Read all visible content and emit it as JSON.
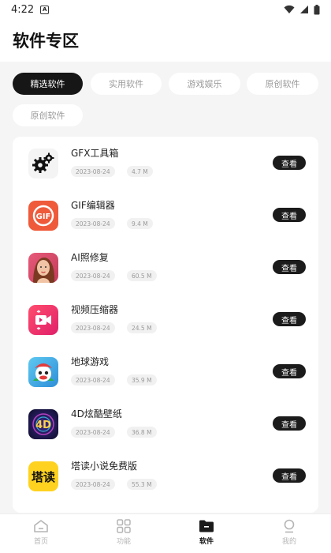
{
  "status_bar": {
    "time": "4:22",
    "badge": "A"
  },
  "header": {
    "title": "软件专区"
  },
  "tabs": [
    {
      "label": "精选软件",
      "active": true
    },
    {
      "label": "实用软件",
      "active": false
    },
    {
      "label": "游戏娱乐",
      "active": false
    },
    {
      "label": "原创软件",
      "active": false
    },
    {
      "label": "原创软件",
      "active": false
    }
  ],
  "apps": [
    {
      "name": "GFX工具箱",
      "date": "2023-08-24",
      "size": "4.7 M",
      "button": "查看",
      "icon": "gear-icon"
    },
    {
      "name": "GIF编辑器",
      "date": "2023-08-24",
      "size": "9.4 M",
      "button": "查看",
      "icon": "gif-icon"
    },
    {
      "name": "AI照修复",
      "date": "2023-08-24",
      "size": "60.5 M",
      "button": "查看",
      "icon": "portrait-icon"
    },
    {
      "name": "视频压缩器",
      "date": "2023-08-24",
      "size": "24.5 M",
      "button": "查看",
      "icon": "video-icon"
    },
    {
      "name": "地球游戏",
      "date": "2023-08-24",
      "size": "35.9 M",
      "button": "查看",
      "icon": "cartoon-icon"
    },
    {
      "name": "4D炫酷壁纸",
      "date": "2023-08-24",
      "size": "36.8 M",
      "button": "查看",
      "icon": "4d-icon"
    },
    {
      "name": "塔读小说免费版",
      "date": "2023-08-24",
      "size": "55.3 M",
      "button": "查看",
      "icon": "tadu-icon",
      "icon_text": "塔读"
    }
  ],
  "bottom_nav": [
    {
      "label": "首页",
      "icon": "home-icon",
      "active": false
    },
    {
      "label": "功能",
      "icon": "grid-icon",
      "active": false
    },
    {
      "label": "软件",
      "icon": "folder-icon",
      "active": true
    },
    {
      "label": "我的",
      "icon": "user-icon",
      "active": false
    }
  ],
  "colors": {
    "accent": "#161616",
    "background": "#f5f5f5",
    "card": "#ffffff",
    "muted": "#9a9a9a"
  }
}
